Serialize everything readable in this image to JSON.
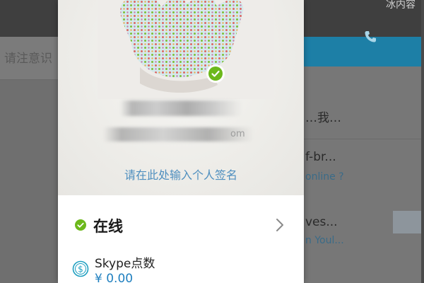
{
  "background_app": {
    "search_placeholder": "请注意识",
    "topbar_text": "冰内容",
    "list_lines": [
      "…我…",
      "f-br...",
      "online ?",
      "ves...",
      "n Youl..."
    ]
  },
  "profile": {
    "email_suffix": "om",
    "signature_placeholder": "请在此处输入个人签名",
    "status": {
      "label": "在线",
      "color": "#6cb81b"
    },
    "credit": {
      "title": "Skype点数",
      "value": "¥ 0.00"
    }
  },
  "colors": {
    "accent": "#1f7fbf",
    "online": "#6cb81b",
    "signature": "#4f8fbf"
  },
  "icons": [
    "check-icon",
    "chevron-right-icon",
    "dollar-coin-icon",
    "phone-icon"
  ]
}
